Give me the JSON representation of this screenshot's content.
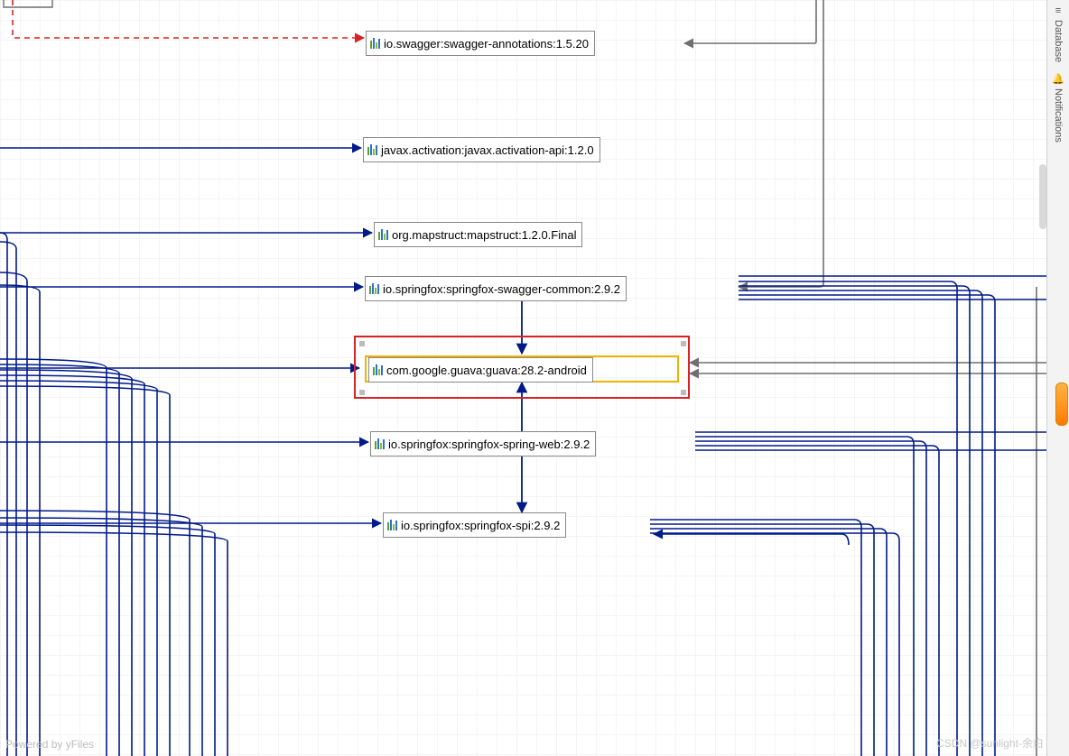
{
  "nodes": {
    "swagger": {
      "label": "io.swagger:swagger-annotations:1.5.20"
    },
    "javax": {
      "label": "javax.activation:javax.activation-api:1.2.0"
    },
    "mapstruct": {
      "label": "org.mapstruct:mapstruct:1.2.0.Final"
    },
    "sfcommon": {
      "label": "io.springfox:springfox-swagger-common:2.9.2"
    },
    "guava": {
      "label": "com.google.guava:guava:28.2-android"
    },
    "sfweb": {
      "label": "io.springfox:springfox-spring-web:2.9.2"
    },
    "sfspi": {
      "label": "io.springfox:springfox-spi:2.9.2"
    }
  },
  "sidebar": {
    "tab1": "Database",
    "tab2": "Notifications"
  },
  "footer": {
    "powered": "Powered by yFiles",
    "watermark": "CSDN @sunlight-余白"
  },
  "diagram": {
    "selected_node": "guava",
    "edges": [
      {
        "from": "off-left-top",
        "to": "swagger",
        "style": "red-dashed"
      },
      {
        "from": "off-left",
        "to": "javax",
        "style": "navy"
      },
      {
        "from": "off-left",
        "to": "mapstruct",
        "style": "navy"
      },
      {
        "from": "off-left",
        "to": "sfcommon",
        "style": "navy"
      },
      {
        "from": "sfcommon",
        "to": "guava",
        "style": "navy"
      },
      {
        "from": "sfweb",
        "to": "guava",
        "style": "navy"
      },
      {
        "from": "off-left",
        "to": "guava",
        "style": "navy"
      },
      {
        "from": "off-left",
        "to": "sfweb",
        "style": "navy"
      },
      {
        "from": "guava",
        "to": "sfspi",
        "style": "navy"
      },
      {
        "from": "off-left",
        "to": "sfspi",
        "style": "navy"
      },
      {
        "from": "off-right",
        "to": "swagger",
        "style": "gray"
      },
      {
        "from": "off-right",
        "to": "sfcommon",
        "style": "gray"
      },
      {
        "from": "off-right",
        "to": "guava",
        "style": "gray"
      },
      {
        "from": "sfcommon",
        "to": "off-right",
        "style": "navy-multi"
      },
      {
        "from": "sfweb",
        "to": "off-right",
        "style": "navy-multi"
      },
      {
        "from": "sfspi",
        "to": "off-right",
        "style": "navy-multi"
      }
    ]
  }
}
